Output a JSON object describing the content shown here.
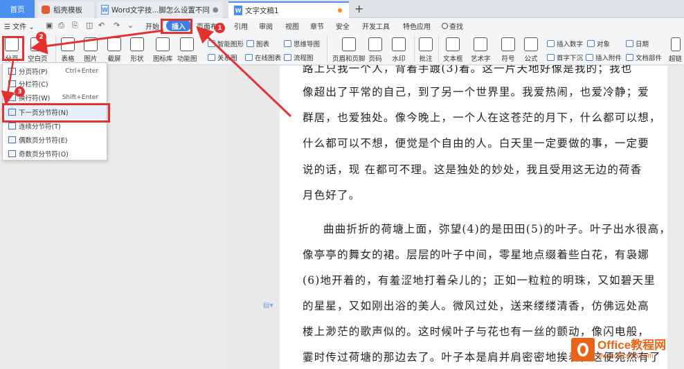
{
  "tabs": {
    "home": "首页",
    "docer": "稻壳模板",
    "doc2": "Word文字技...脚怎么设置不同",
    "doc3": "文字文稿1",
    "add": "+"
  },
  "menu": {
    "file": "☰ 文件 ⌄",
    "items": [
      "开始",
      "插入",
      "页面布局",
      "引用",
      "审阅",
      "视图",
      "章节",
      "安全",
      "开发工具",
      "特色应用"
    ],
    "search": "查找"
  },
  "ribbon": {
    "page_break": "分页",
    "blank_page": "空白页",
    "table": "表格",
    "picture": "图片",
    "screenshot": "截屏",
    "shape": "形状",
    "icon_lib": "图标库",
    "func_chart": "功能图",
    "smart_shape": "智能图形",
    "chart": "图表",
    "mind_map": "思维导图",
    "relation": "关系图",
    "online_chart": "在线图表",
    "flowchart": "流程图",
    "header_footer": "页眉和页脚",
    "page_number": "页码",
    "watermark": "水印",
    "comment": "批注",
    "text_box": "文本框",
    "art_text": "艺术字",
    "symbol": "符号",
    "formula": "公式",
    "insert_number": "插入数字",
    "object": "对象",
    "drop_cap": "首字下沉",
    "attachment": "插入附件",
    "date": "日期",
    "doc_parts": "文档部件",
    "super_link": "超链"
  },
  "dropdown": [
    {
      "label": "分页符(P)",
      "shortcut": "Ctrl+Enter"
    },
    {
      "label": "分栏符(C)",
      "shortcut": ""
    },
    {
      "label": "换行符(W)",
      "shortcut": "Shift+Enter"
    },
    {
      "label": "下一页分节符(N)",
      "shortcut": ""
    },
    {
      "label": "连续分节符(T)",
      "shortcut": ""
    },
    {
      "label": "偶数页分节符(E)",
      "shortcut": ""
    },
    {
      "label": "奇数页分节符(O)",
      "shortcut": ""
    }
  ],
  "badges": [
    "1",
    "2",
    "3"
  ],
  "document": {
    "lines": [
      "路上只我一个人，背着手踱(3)着。这一片天地好像是我的；我也",
      "像超出了平常的自己，到了另一个世界里。我爱热闹，也爱冷静；爱",
      "群居，也爱独处。像今晚上，一个人在这苍茫的月下，什么都可以想，",
      "什么都可以不想，便觉是个自由的人。白天里一定要做的事，一定要",
      "说的话，现 在都可不理。这是独处的妙处，我且受用这无边的荷香",
      "月色好了。",
      "曲曲折折的荷塘上面，弥望(4)的是田田(5)的叶子。叶子出水很高，",
      "像亭亭的舞女的裙。层层的叶子中间，零星地点缀着些白花，有袅娜",
      "(6)地开着的，有羞涩地打着朵儿的；正如一粒粒的明珠，又如碧天里",
      "的星星，又如刚出浴的美人。微风过处，送来缕缕清香，仿佛远处高",
      "楼上渺茫的歌声似的。这时候叶子与花也有一丝的颤动，像闪电般，",
      "霎时传过荷塘的那边去了。叶子本是肩并肩密密地挨着，这便宛然有了"
    ]
  },
  "watermark": {
    "main": "Office教程网",
    "sub": "www.office26.com"
  }
}
